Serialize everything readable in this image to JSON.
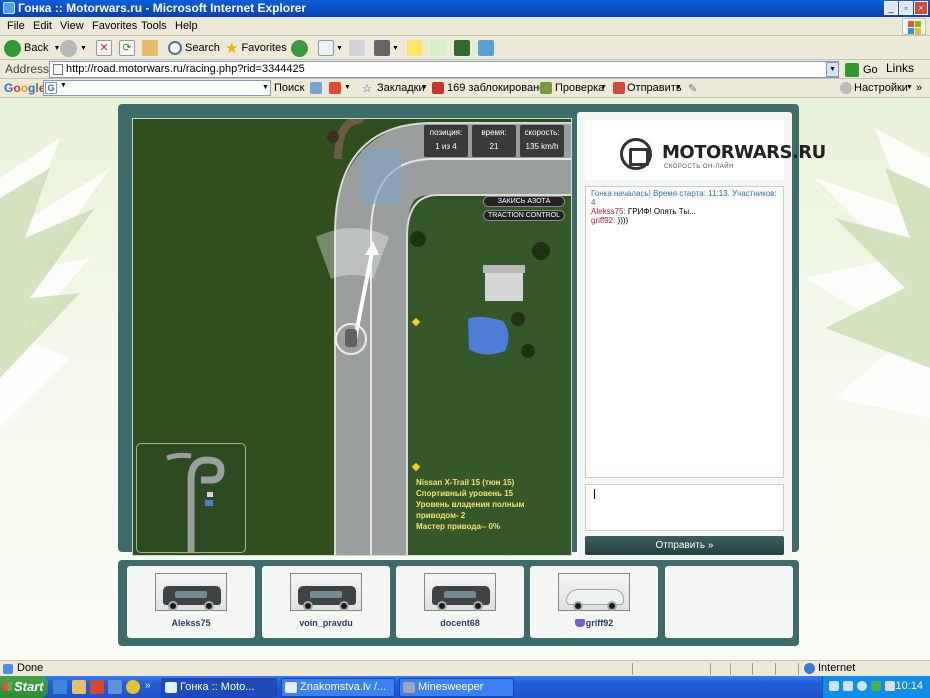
{
  "window": {
    "title": "Гонка :: Motorwars.ru - Microsoft Internet Explorer"
  },
  "menu": [
    "File",
    "Edit",
    "View",
    "Favorites",
    "Tools",
    "Help"
  ],
  "toolbar": {
    "back": "Back",
    "search": "Search",
    "favorites": "Favorites"
  },
  "address": {
    "label": "Address",
    "url": "http://road.motorwars.ru/racing.php?rid=3344425",
    "go": "Go",
    "links": "Links"
  },
  "google": {
    "logo": "Google",
    "search_label": "Поиск",
    "bookmarks": "Закладки",
    "blocked": "169 заблокировано",
    "check": "Проверка",
    "send": "Отправить",
    "settings": "Настройки"
  },
  "hud": {
    "position_label": "позиция:",
    "position_value": "1 из 4",
    "time_label": "время:",
    "time_value": "21",
    "speed_label": "скорость:",
    "speed_value": "135 km/h",
    "nitro": "ЗАКИСЬ АЗОТА",
    "traction": "TRACTION CONTROL"
  },
  "car_info": [
    "Nissan X-Trail 15 (тюн 15)",
    "Спортивный уровень 15",
    "Уровень владения полным",
    "приводом- 2",
    "Мастер привода-- 0%"
  ],
  "logo": {
    "name": "MOTORWARS.RU",
    "tagline": "СКОРОСТЬ ОН-ЛАЙН"
  },
  "chat": {
    "system": "Гонка началась! Время старта: 11:13. Участников: 4",
    "messages": [
      {
        "nick": "Alekss75:",
        "text": " ГРИФ! Опять Ты..."
      },
      {
        "nick": "griff92:",
        "text": " ))))"
      }
    ],
    "send_button": "Отправить »"
  },
  "players": [
    {
      "name": "Alekss75",
      "car": "dark"
    },
    {
      "name": "voin_pravdu",
      "car": "dark"
    },
    {
      "name": "docent68",
      "car": "dark"
    },
    {
      "name": "griff92",
      "car": "white"
    }
  ],
  "status": {
    "text": "Done",
    "zone": "Internet"
  },
  "taskbar": {
    "start": "Start",
    "tasks": [
      "Гонка :: Moto...",
      "Znakomstva.lv /...",
      "Minesweeper"
    ],
    "clock": "10:14"
  }
}
